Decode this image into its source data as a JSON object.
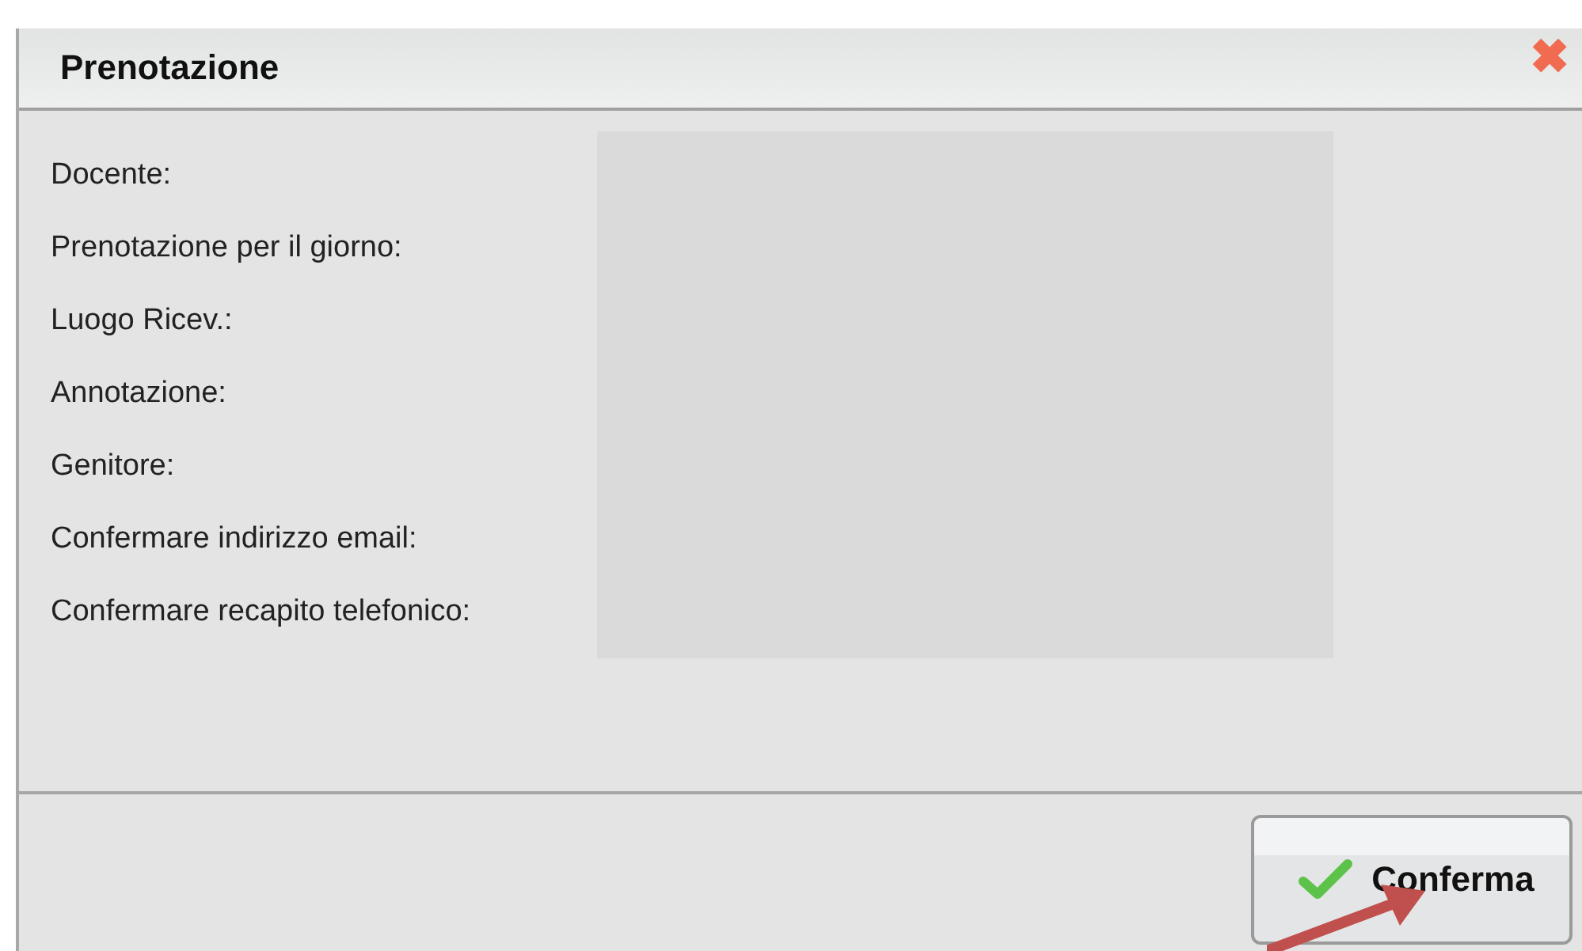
{
  "dialog": {
    "title": "Prenotazione",
    "close_icon": "✖",
    "fields": [
      {
        "label": "Docente:"
      },
      {
        "label": "Prenotazione per il giorno:"
      },
      {
        "label": "Luogo Ricev.:"
      },
      {
        "label": "Annotazione:"
      },
      {
        "label": "Genitore:"
      },
      {
        "label": "Confermare indirizzo email:"
      },
      {
        "label": "Confermare recapito telefonico:"
      }
    ],
    "buttons": [
      {
        "label": "Conferma"
      }
    ]
  }
}
